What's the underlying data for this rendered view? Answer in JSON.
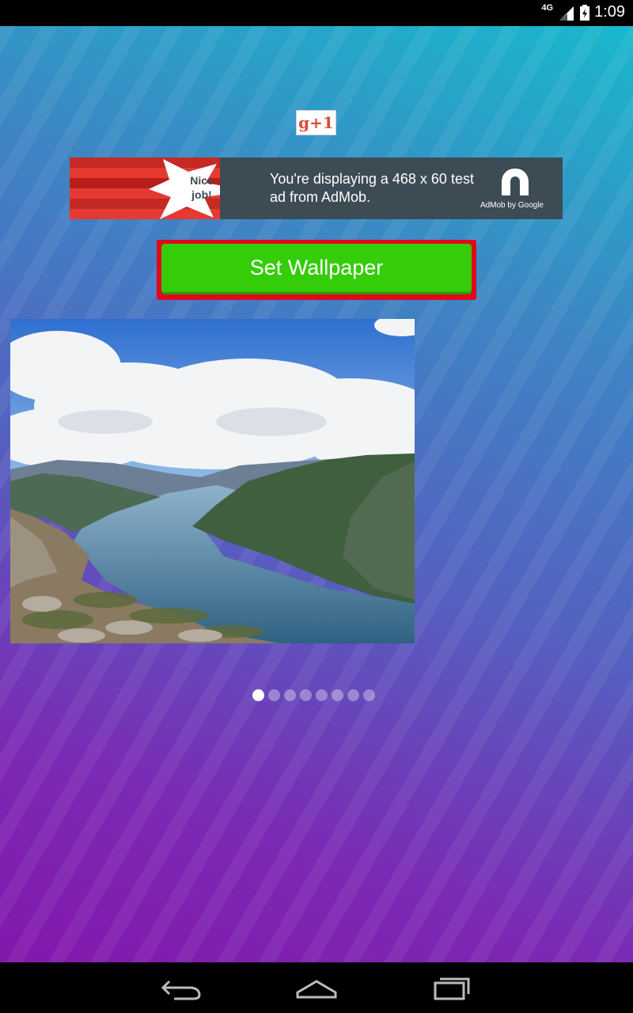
{
  "status_bar": {
    "time": "1:09",
    "network": "4G",
    "icons": [
      "signal-icon",
      "battery-icon"
    ]
  },
  "social": {
    "gplus_label": "g+1",
    "icon": "google-plus-one-icon"
  },
  "ad": {
    "badge_text": "Nice job!",
    "message": "You're displaying a 468 x 60 test ad from AdMob.",
    "brand": "AdMob by Google",
    "colors": {
      "background": "#3d4b55",
      "ribbon": "#e53a31"
    }
  },
  "actions": {
    "set_wallpaper_label": "Set Wallpaper",
    "colors": {
      "button": "#35cc0a",
      "border": "#e0091c"
    }
  },
  "gallery": {
    "current_image": "fjord-landscape",
    "page_count": 8,
    "current_index": 0
  },
  "nav_bar": {
    "buttons": [
      "back-icon",
      "home-icon",
      "recents-icon"
    ]
  }
}
